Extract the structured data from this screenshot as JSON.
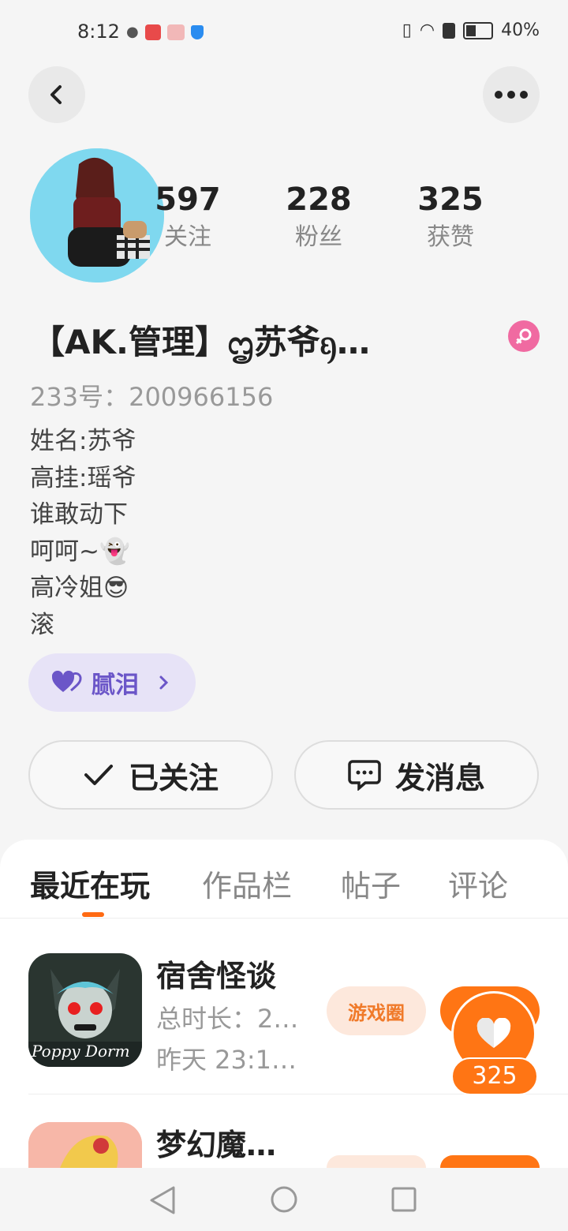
{
  "status_bar": {
    "time": "8:12",
    "battery": "40%"
  },
  "profile": {
    "stats": [
      {
        "value": "597",
        "label": "关注"
      },
      {
        "value": "228",
        "label": "粉丝"
      },
      {
        "value": "325",
        "label": "获赞"
      }
    ],
    "nickname": "【AK.管理】ᦗ苏爷ᦏ…",
    "uid": "233号：200966156",
    "bio": [
      "姓名:苏爷",
      "高挂:瑶爷",
      "谁敢动下",
      "呵呵~👻",
      "高冷姐😎",
      "滚"
    ],
    "tag": "腻泪",
    "follow_button": "已关注",
    "message_button": "发消息"
  },
  "tabs": [
    "最近在玩",
    "作品栏",
    "帖子",
    "评论"
  ],
  "games": [
    {
      "title": "宿舍怪谈",
      "duration": "总时长：2…",
      "last_played": "昨天 23:1…",
      "circle_label": "游戏圈",
      "icon_text": "Poppy Dorm"
    },
    {
      "title": "梦幻魔…"
    }
  ],
  "likes": "325",
  "colors": {
    "accent": "#ff7514",
    "tag_purple": "#6b56c8",
    "gender_pink": "#f06aa1"
  }
}
